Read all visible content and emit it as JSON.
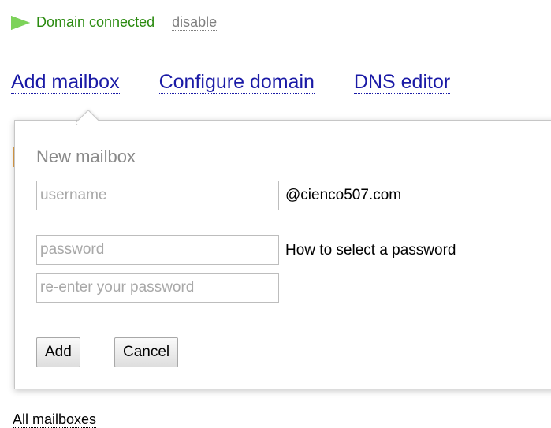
{
  "status": {
    "icon": "play-icon",
    "text": "Domain connected",
    "disable_label": "disable"
  },
  "tabs": [
    {
      "label": "Add mailbox"
    },
    {
      "label": "Configure domain"
    },
    {
      "label": "DNS editor"
    }
  ],
  "popup": {
    "title": "New mailbox",
    "username_placeholder": "username",
    "domain_suffix": "@cienco507.com",
    "password_placeholder": "password",
    "password_help_label": "How to select a password",
    "repassword_placeholder": "re-enter your password",
    "add_label": "Add",
    "cancel_label": "Cancel"
  },
  "footer": {
    "all_mailboxes_label": "All mailboxes"
  },
  "colors": {
    "status_green": "#2a8a0f",
    "link_blue": "#1a1aa6",
    "icon_green": "#7dd35a"
  }
}
